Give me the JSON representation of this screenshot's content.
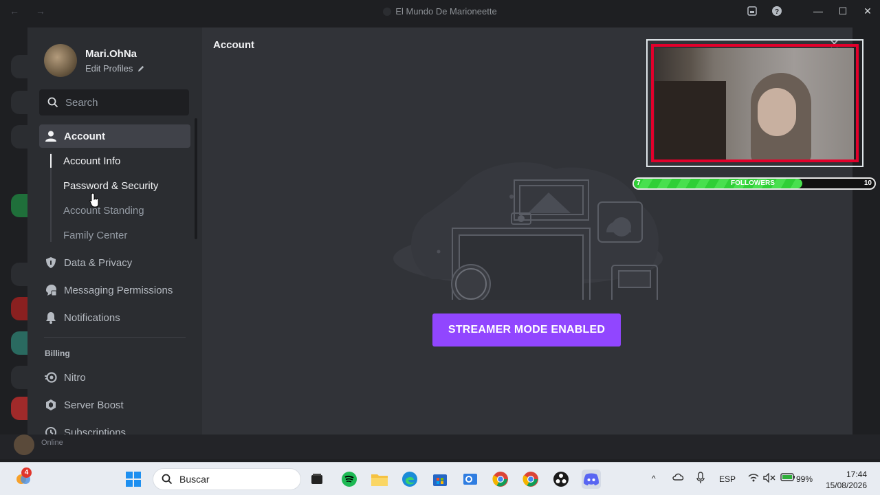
{
  "window": {
    "title": "El Mundo De Marioneette",
    "minimize": "—",
    "maximize": "☐",
    "close": "✕"
  },
  "profile": {
    "name": "Mari.OhNa",
    "edit_label": "Edit Profiles"
  },
  "search": {
    "placeholder": "Search"
  },
  "sidebar": {
    "account": "Account",
    "sub_items": [
      "Account Info",
      "Password & Security",
      "Account Standing",
      "Family Center"
    ],
    "items": [
      "Data & Privacy",
      "Messaging Permissions",
      "Notifications"
    ],
    "billing_header": "Billing",
    "billing_items": [
      "Nitro",
      "Server Boost",
      "Subscriptions"
    ]
  },
  "main": {
    "title": "Account",
    "streamer_button": "STREAMER MODE ENABLED",
    "accent_color": "#9146ff"
  },
  "overlay": {
    "followers_label": "FOLLOWERS",
    "followers_min": "7",
    "followers_max": "10",
    "progress_fraction": 0.7
  },
  "background": {
    "status": "Online"
  },
  "taskbar": {
    "notification_count": "4",
    "search_label": "Buscar",
    "language": "ESP",
    "battery": "99%",
    "time": "17:44",
    "date": "15/08/2026"
  }
}
